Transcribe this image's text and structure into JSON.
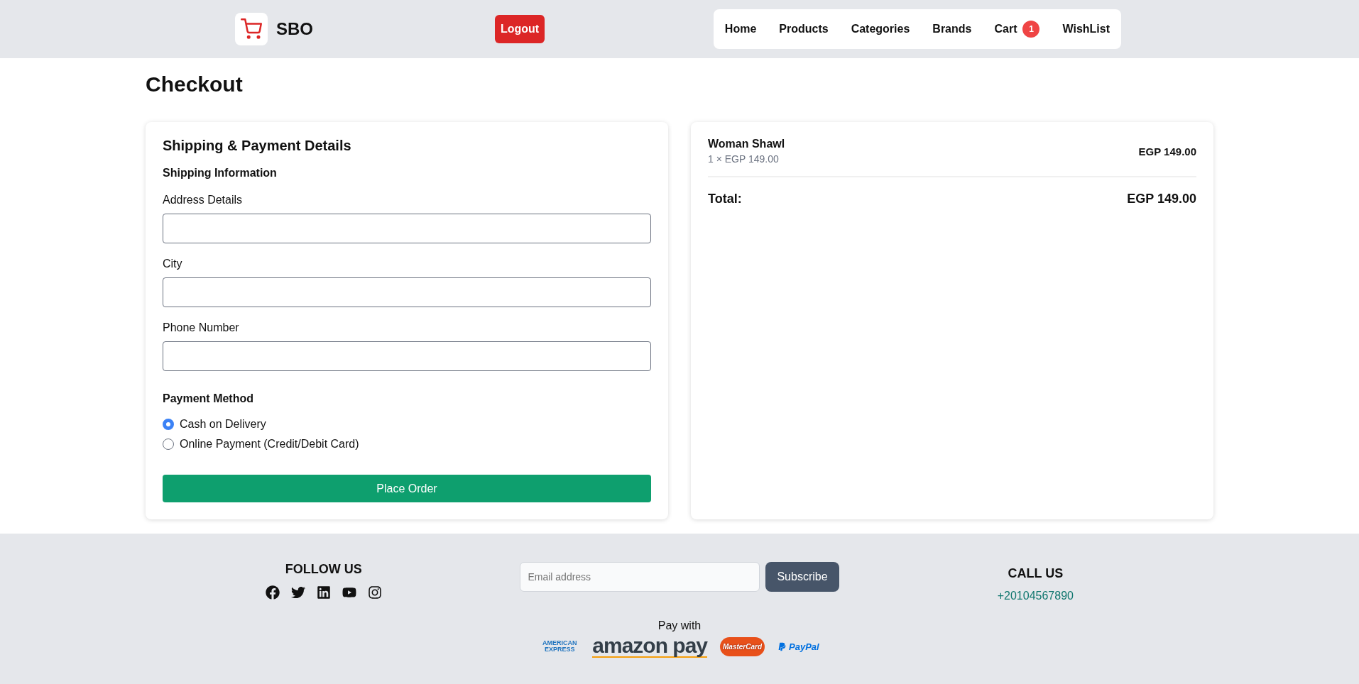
{
  "header": {
    "brand": "SBO",
    "logout": "Logout",
    "nav": [
      {
        "label": "Home"
      },
      {
        "label": "Products"
      },
      {
        "label": "Categories"
      },
      {
        "label": "Brands"
      },
      {
        "label": "Cart",
        "badge": "1"
      },
      {
        "label": "WishList"
      }
    ]
  },
  "page_title": "Checkout",
  "form": {
    "title": "Shipping & Payment Details",
    "shipping_heading": "Shipping Information",
    "fields": [
      {
        "label": "Address Details"
      },
      {
        "label": "City"
      },
      {
        "label": "Phone Number"
      }
    ],
    "payment_heading": "Payment Method",
    "payment_options": [
      {
        "label": "Cash on Delivery",
        "selected": true
      },
      {
        "label": "Online Payment (Credit/Debit Card)",
        "selected": false
      }
    ],
    "submit": "Place Order"
  },
  "summary": {
    "items": [
      {
        "name": "Woman Shawl",
        "detail": "1 × EGP 149.00",
        "price": "EGP 149.00"
      }
    ],
    "total_label": "Total:",
    "total": "EGP 149.00"
  },
  "footer": {
    "follow_title": "FOLLOW US",
    "email_placeholder": "Email address",
    "subscribe": "Subscribe",
    "call_title": "CALL US",
    "phone": "+20104567890",
    "pay_with": "Pay with",
    "payment_logos": [
      {
        "kind": "amex",
        "text": "AMERICAN EXPRESS"
      },
      {
        "kind": "amazon",
        "text": "amazon pay"
      },
      {
        "kind": "mastercard",
        "text": "MasterCard"
      },
      {
        "kind": "paypal",
        "text": "PayPal"
      }
    ]
  }
}
